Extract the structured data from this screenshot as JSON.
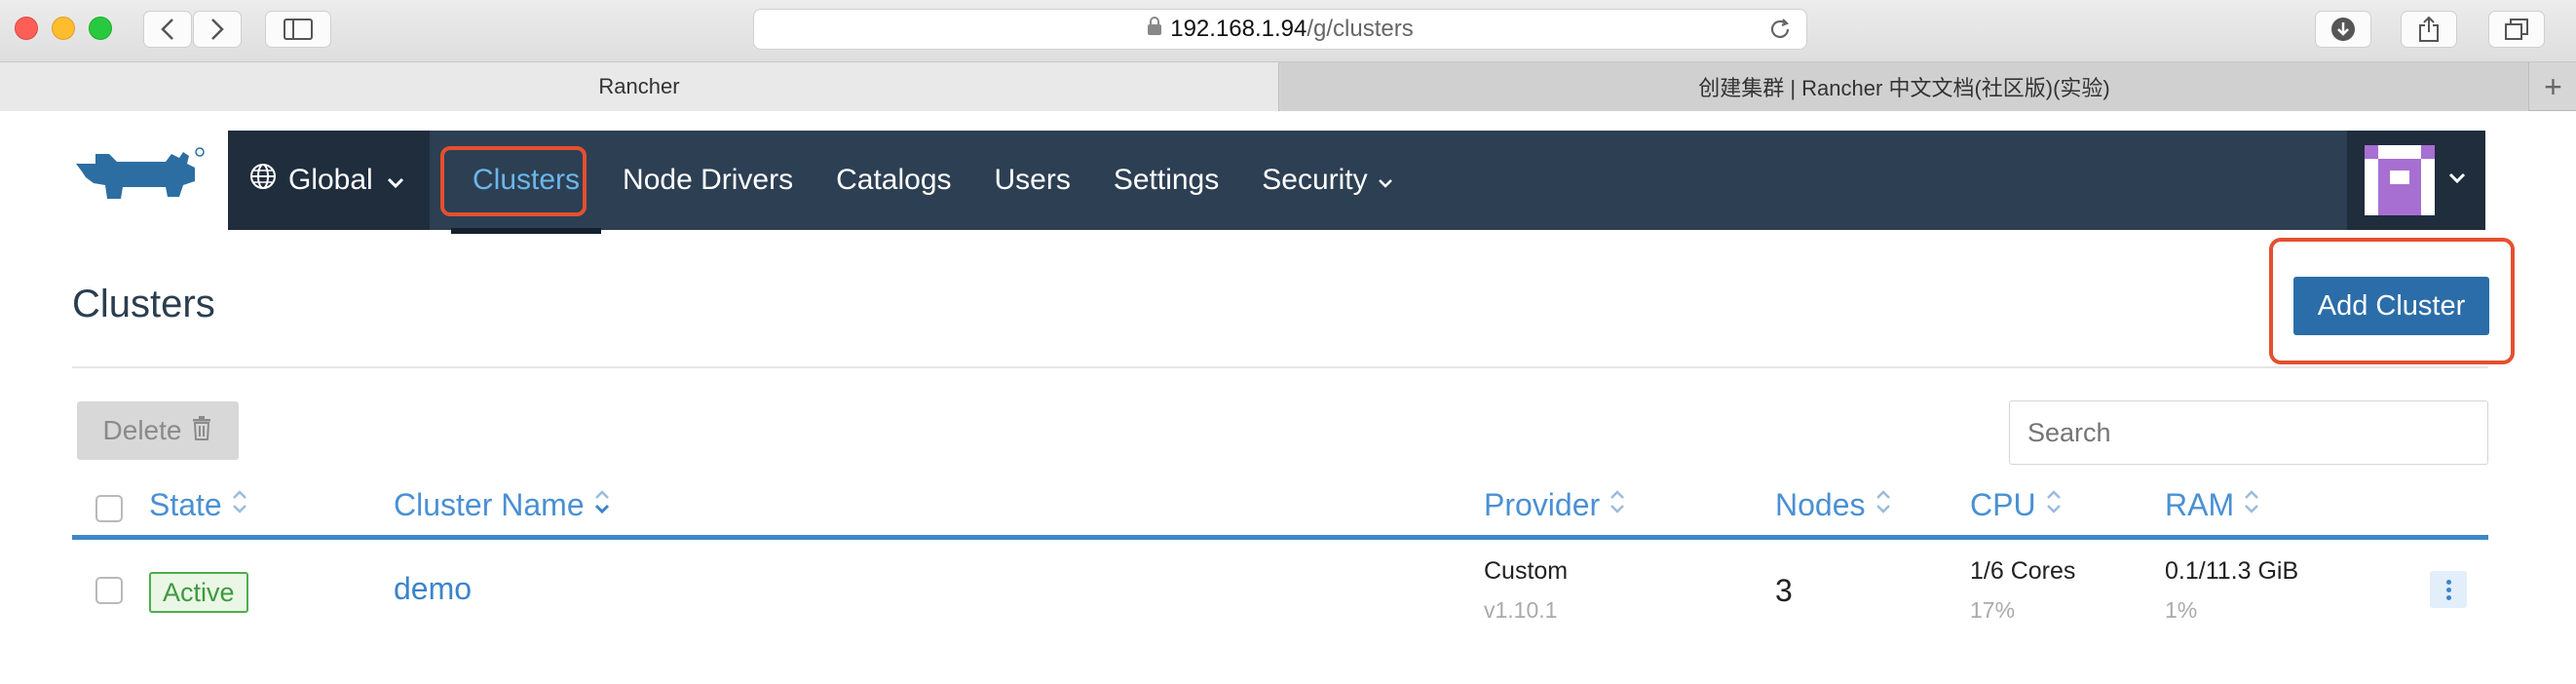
{
  "browser": {
    "url_host": "192.168.1.94",
    "url_path": "/g/clusters",
    "tabs": [
      {
        "title": "Rancher"
      },
      {
        "title": "创建集群 | Rancher 中文文档(社区版)(实验)"
      }
    ],
    "new_tab_symbol": "+"
  },
  "nav": {
    "global_label": "Global",
    "links": [
      {
        "label": "Clusters"
      },
      {
        "label": "Node Drivers"
      },
      {
        "label": "Catalogs"
      },
      {
        "label": "Users"
      },
      {
        "label": "Settings"
      },
      {
        "label": "Security"
      }
    ],
    "active_color": "#6ab7ea",
    "bar_color": "#2d3f53"
  },
  "page": {
    "title": "Clusters",
    "add_button": "Add Cluster",
    "delete_button": "Delete",
    "search_placeholder": "Search"
  },
  "table": {
    "columns": [
      "State",
      "Cluster Name",
      "Provider",
      "Nodes",
      "CPU",
      "RAM"
    ],
    "rows": [
      {
        "state": "Active",
        "name": "demo",
        "provider": "Custom",
        "provider_version": "v1.10.1",
        "nodes": "3",
        "cpu": "1/6 Cores",
        "cpu_pct": "17%",
        "ram": "0.1/11.3 GiB",
        "ram_pct": "1%"
      }
    ]
  },
  "highlight_color": "#e4502f",
  "icons": [
    "back-icon",
    "forward-icon",
    "sidebar-icon",
    "lock-icon",
    "reload-icon",
    "download-icon",
    "share-icon",
    "tabs-icon",
    "rancher-logo",
    "globe-icon",
    "chevron-down-icon",
    "trash-icon",
    "sort-icon",
    "kebab-icon"
  ]
}
